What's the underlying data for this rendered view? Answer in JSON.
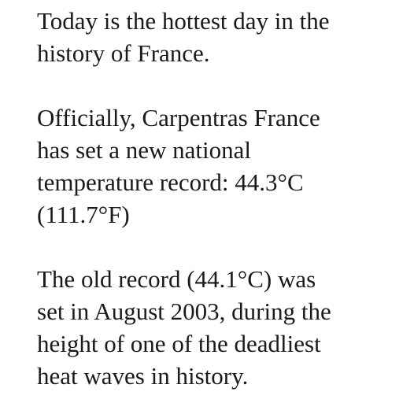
{
  "paragraphs": [
    {
      "lines": [
        "Today is the hottest day in the",
        "history of France."
      ]
    },
    {
      "lines": [
        "Officially, Carpentras France",
        "has set a new national",
        "temperature record: 44.3°C",
        "(111.7°F)"
      ]
    },
    {
      "lines": [
        "The old record (44.1°C) was",
        "set in August 2003, during the",
        "height of one of the deadliest",
        "heat waves in history."
      ]
    }
  ]
}
